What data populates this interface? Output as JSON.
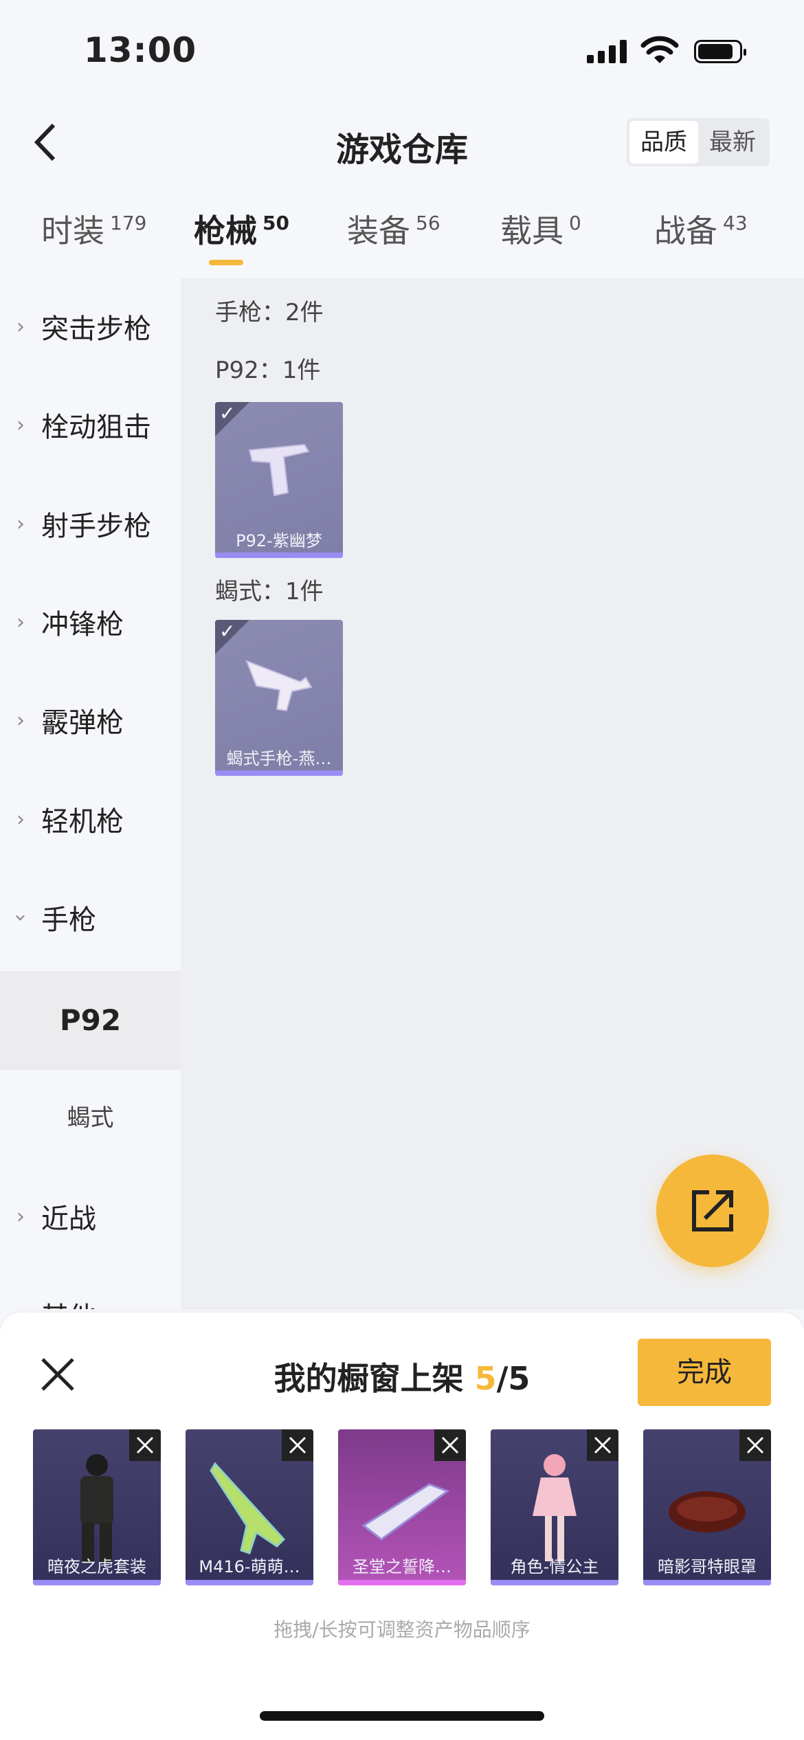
{
  "status": {
    "time": "13:00"
  },
  "header": {
    "title": "游戏仓库",
    "sort_quality": "品质",
    "sort_latest": "最新"
  },
  "tabs": [
    {
      "label": "时装",
      "count": "179"
    },
    {
      "label": "枪械",
      "count": "50"
    },
    {
      "label": "装备",
      "count": "56"
    },
    {
      "label": "载具",
      "count": "0"
    },
    {
      "label": "战备",
      "count": "43"
    }
  ],
  "sidebar": {
    "categories": [
      "突击步枪",
      "栓动狙击",
      "射手步枪",
      "冲锋枪",
      "霰弹枪",
      "轻机枪",
      "手枪",
      "近战",
      "其他"
    ],
    "sub_active": "P92",
    "sub_other": "蝎式"
  },
  "content": {
    "group_title": "手枪：2件",
    "group1": "P92：1件",
    "item1": "P92-紫幽梦",
    "group2": "蝎式：1件",
    "item2": "蝎式手枪-燕…"
  },
  "sheet": {
    "title": "我的橱窗上架",
    "count_current": "5",
    "count_total": "/5",
    "done": "完成",
    "items": [
      "暗夜之虎套装",
      "M416-萌萌…",
      "圣堂之誓降…",
      "角色-情公主",
      "暗影哥特眼罩"
    ],
    "hint": "拖拽/长按可调整资产物品顺序"
  },
  "colors": {
    "accent": "#f5b83a",
    "card_purple": "#8c8bb1",
    "card_bar": "#9b8cf4"
  }
}
